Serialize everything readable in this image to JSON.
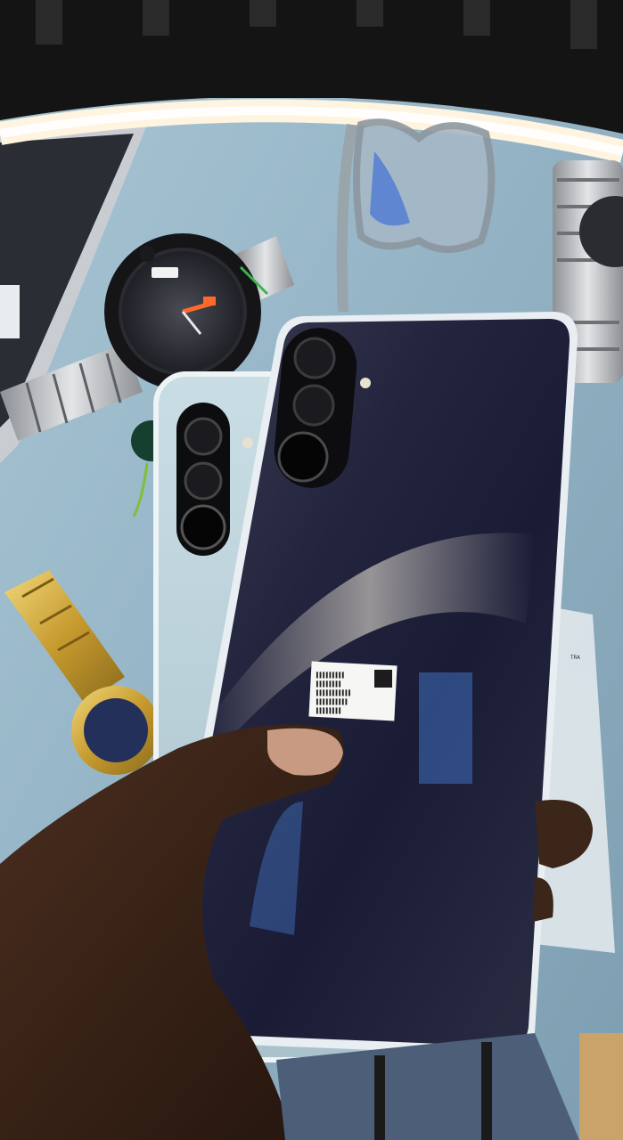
{
  "scene": {
    "description_free": true,
    "colors": {
      "cloth": "#9dbccb",
      "cloth_shadow": "#6f8fa1",
      "ring_light": "#fff6e6",
      "ring_dark": "#151515",
      "phone_front_back": "#1d1f3a",
      "phone_back_panel": "#b9d1da",
      "phone_frame": "#e8eef2",
      "camera_black": "#0d0d0f",
      "gold": "#caa33c",
      "skin": "#3a2418",
      "watch_dark": "#1a1a1d",
      "steel": "#b9bcc0"
    },
    "icons": [
      "ring-light",
      "wristwatch-black",
      "wristwatch-gold",
      "wristwatch-steel",
      "eyeglasses",
      "smartphone-front",
      "smartphone-back",
      "hand",
      "plastic-bag"
    ],
    "sticker_lines": [
      "▌▌▌▌▌▌▌▌▌",
      "▌▌▌▌▌▌▌▌",
      "▌▌▌▌▌▌▌▌▌▌▌",
      "▌▌▌▌▌▌▌▌▌▌",
      "▌▌▌▌▌▌▌▌"
    ]
  }
}
